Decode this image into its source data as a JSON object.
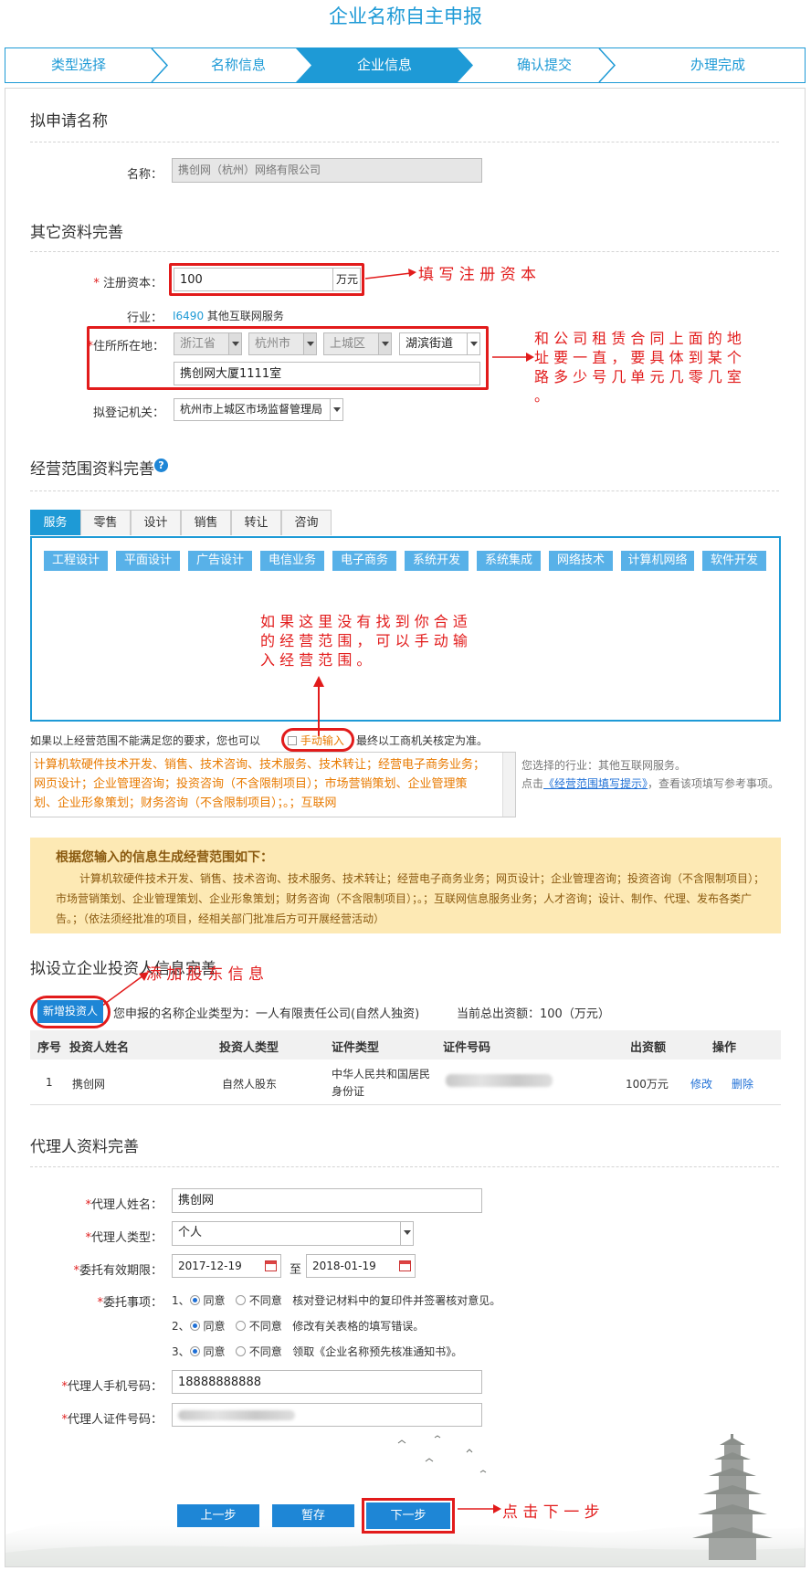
{
  "page_title": "企业名称自主申报",
  "steps": [
    "类型选择",
    "名称信息",
    "企业信息",
    "确认提交",
    "办理完成"
  ],
  "section1": {
    "title": "拟申请名称",
    "name_label": "名称：",
    "name_value": "携创网（杭州）网络有限公司"
  },
  "section2": {
    "title": "其它资料完善",
    "capital_label": "注册资本：",
    "capital_value": "100",
    "capital_unit": "万元",
    "capital_note": "填 写 注 册 资 本",
    "industry_label": "行业：",
    "industry_code": "I6490",
    "industry_name": "其他互联网服务",
    "address_label": "住所所在地：",
    "province": "浙江省",
    "city": "杭州市",
    "district": "上城区",
    "street": "湖滨街道",
    "address_detail": "携创网大厦1111室",
    "address_note": "和 公 司 租 赁 合 同 上 面 的 地 址 要 一 直 ， 要 具 体 到 某 个 路 多 少 号 几 单 元 几 零 几 室 。",
    "authority_label": "拟登记机关：",
    "authority_value": "杭州市上城区市场监督管理局"
  },
  "section3": {
    "title": "经营范围资料完善",
    "help_icon": "?",
    "tabs": [
      "服务",
      "零售",
      "设计",
      "销售",
      "转让",
      "咨询"
    ],
    "chips": [
      "工程设计",
      "平面设计",
      "广告设计",
      "电信业务",
      "电子商务",
      "系统开发",
      "系统集成",
      "网络技术",
      "计算机网络",
      "软件开发"
    ],
    "scope_note": "如 果 这 里 没 有 找 到 你 合 适 的 经 营 范 围 ， 可 以 手 动 输 入 经 营 范 围 。",
    "manual_text_before": "如果以上经营范围不能满足您的要求，您也可以",
    "manual_link": "手动输入",
    "manual_text_after": "最终以工商机关核定为准。",
    "scope_textarea": "计算机软硬件技术开发、销售、技术咨询、技术服务、技术转让；经营电子商务业务；网页设计；企业管理咨询；投资咨询（不含限制项目）；市场营销策划、企业管理策划、企业形象策划；财务咨询（不含限制项目）；。；互联网",
    "industry_hint": "您选择的行业：其他互联网服务。",
    "hint_prefix": "点击",
    "hint_link": "《经营范围填写提示》",
    "hint_suffix": "，查看该项填写参考事项。",
    "generated_title": "根据您输入的信息生成经营范围如下：",
    "generated_text": "计算机软硬件技术开发、销售、技术咨询、技术服务、技术转让；经营电子商务业务；网页设计；企业管理咨询；投资咨询（不含限制项目）；市场营销策划、企业管理策划、企业形象策划；财务咨询（不含限制项目）；。；互联网信息服务业务；人才咨询；设计、制作、代理、发布各类广告。；（依法须经批准的项目，经相关部门批准后方可开展经营活动）"
  },
  "section4": {
    "title": "拟设立企业投资人信息完善",
    "title_note": "添 加 股 东 信 息",
    "add_button": "新增投资人",
    "company_type_text": "您申报的名称企业类型为：一人有限责任公司(自然人独资)",
    "total_capital_text": "当前总出资额：100（万元）",
    "columns": [
      "序号",
      "投资人姓名",
      "投资人类型",
      "证件类型",
      "证件号码",
      "出资额",
      "操作"
    ],
    "row": {
      "index": "1",
      "name": "携创网",
      "type": "自然人股东",
      "id_type": "中华人民共和国居民身份证",
      "amount": "100万元",
      "edit": "修改",
      "delete": "删除"
    }
  },
  "section5": {
    "title": "代理人资料完善",
    "agent_name_label": "代理人姓名：",
    "agent_name_value": "携创网",
    "agent_type_label": "代理人类型：",
    "agent_type_value": "个人",
    "period_label": "委托有效期限：",
    "period_from": "2017-12-19",
    "period_to_label": "至",
    "period_to": "2018-01-19",
    "matters_label": "委托事项：",
    "matters": [
      {
        "num": "1、",
        "agree": "同意",
        "disagree": "不同意",
        "text": "核对登记材料中的复印件并签署核对意见。"
      },
      {
        "num": "2、",
        "agree": "同意",
        "disagree": "不同意",
        "text": "修改有关表格的填写错误。"
      },
      {
        "num": "3、",
        "agree": "同意",
        "disagree": "不同意",
        "text": "领取《企业名称预先核准通知书》。"
      }
    ],
    "phone_label": "代理人手机号码：",
    "phone_value": "18888888888",
    "id_label": "代理人证件号码："
  },
  "footer": {
    "prev_button": "上一步",
    "save_button": "暂存",
    "next_button": "下一步",
    "next_note": "点 击 下 一 步"
  },
  "colors": {
    "accent": "#1e9ad6",
    "annotation_red": "#e21b1b",
    "notice_bg": "#fde9b4"
  }
}
